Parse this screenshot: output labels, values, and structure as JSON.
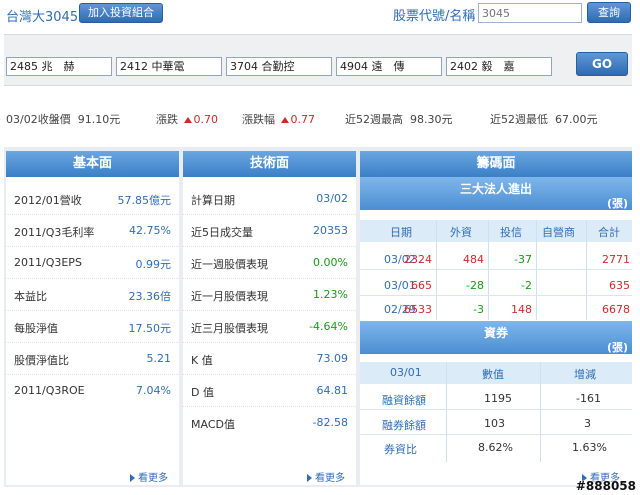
{
  "header": {
    "stock_title": "台灣大3045",
    "add_portfolio_label": "加入投資組合",
    "search_label": "股票代號/名稱",
    "search_placeholder": "3045",
    "query_label": "查詢"
  },
  "compare": {
    "stocks": [
      "2485 兆　赫",
      "2412 中華電",
      "3704 合勤控",
      "4904 遠　傳",
      "2402 毅　嘉"
    ],
    "go_label": "GO"
  },
  "stats": {
    "close_label": "03/02收盤價",
    "close_value": "91.10元",
    "change_label": "漲跌",
    "change_value": "0.70",
    "change_pct_label": "漲跌幅",
    "change_pct_value": "0.77",
    "high52_label": "近52週最高",
    "high52_value": "98.30元",
    "low52_label": "近52週最低",
    "low52_value": "67.00元"
  },
  "fundamentals": {
    "title": "基本面",
    "rows": [
      {
        "label": "2012/01營收",
        "value": "57.85億元"
      },
      {
        "label": "2011/Q3毛利率",
        "value": "42.75%"
      },
      {
        "label": "2011/Q3EPS",
        "value": "0.99元"
      },
      {
        "label": "本益比",
        "value": "23.36倍"
      },
      {
        "label": "每股淨值",
        "value": "17.50元"
      },
      {
        "label": "股價淨值比",
        "value": "5.21"
      },
      {
        "label": "2011/Q3ROE",
        "value": "7.04%"
      }
    ],
    "more_label": "看更多"
  },
  "technicals": {
    "title": "技術面",
    "rows": [
      {
        "label": "計算日期",
        "value": "03/02"
      },
      {
        "label": "近5日成交量",
        "value": "20353"
      },
      {
        "label": "近一週股價表現",
        "value": "0.00%"
      },
      {
        "label": "近一月股價表現",
        "value": "1.23%"
      },
      {
        "label": "近三月股價表現",
        "value": "-4.64%"
      },
      {
        "label": "K 值",
        "value": "73.09"
      },
      {
        "label": "D 值",
        "value": "64.81"
      },
      {
        "label": "MACD值",
        "value": "-82.58"
      }
    ],
    "more_label": "看更多"
  },
  "chips": {
    "title": "籌碼面",
    "institutional": {
      "title": "三大法人進出",
      "unit": "(張)",
      "headers": [
        "日期",
        "外資",
        "投信",
        "自營商",
        "合計"
      ],
      "rows": [
        [
          "03/02",
          "2324",
          "484",
          "-37",
          "2771"
        ],
        [
          "03/01",
          "665",
          "-28",
          "-2",
          "635"
        ],
        [
          "02/29",
          "6533",
          "-3",
          "148",
          "6678"
        ]
      ]
    },
    "margin": {
      "title": "資券",
      "unit": "(張)",
      "headers": [
        "03/01",
        "數值",
        "增減"
      ],
      "rows": [
        [
          "融資餘額",
          "1195",
          "-161"
        ],
        [
          "融券餘額",
          "103",
          "3"
        ],
        [
          "券資比",
          "8.62%",
          "1.63%"
        ]
      ]
    },
    "more_label": "看更多"
  },
  "watermark": "#888058"
}
